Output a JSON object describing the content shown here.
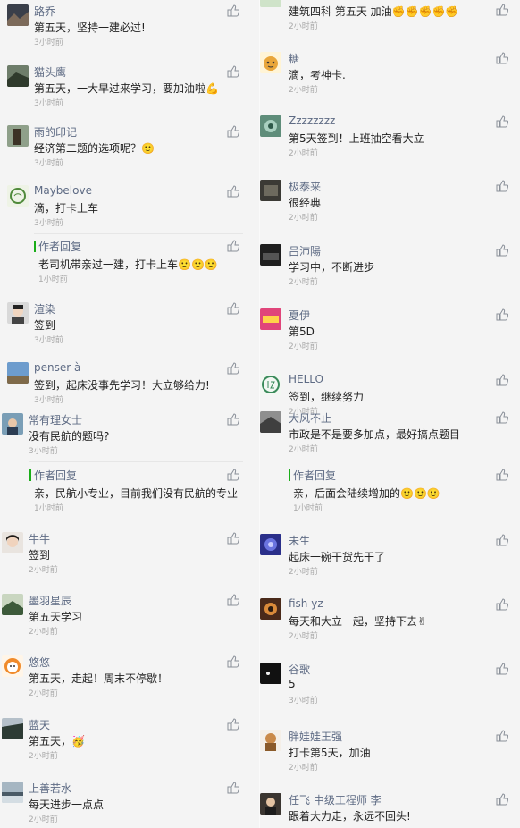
{
  "left": [
    {
      "name": "路乔",
      "text": "第五天，坚持一建必过!",
      "time": "3小时前"
    },
    {
      "name": "猫头鹰",
      "text": "第五天，一大早过来学习，要加油啦💪",
      "time": "3小时前"
    },
    {
      "name": "雨的印记",
      "text": "经济第二题的选项呢？🙂",
      "time": "3小时前"
    },
    {
      "name": "Maybelove",
      "text": "滴，打卡上车",
      "time": "3小时前"
    },
    {
      "reply_label": "作者回复",
      "text": "老司机带亲过一建，打卡上车🙂🙂🙂",
      "time": "1小时前"
    },
    {
      "name": "渲染",
      "text": "签到",
      "time": "3小时前"
    },
    {
      "name": "penser à",
      "text": "签到，起床没事先学习！大立够给力!",
      "time": "3小时前"
    },
    {
      "name": "常有理女士",
      "text": "没有民航的题吗?",
      "time": "3小时前"
    },
    {
      "reply_label": "作者回复",
      "text": "亲，民航小专业，目前我们没有民航的专业",
      "time": "1小时前"
    },
    {
      "name": "牛牛",
      "text": "签到",
      "time": "2小时前"
    },
    {
      "name": "墨羽星辰",
      "text": "第五天学习",
      "time": "2小时前"
    },
    {
      "name": "悠悠",
      "text": "第五天，走起！周末不停歇！",
      "time": "2小时前"
    },
    {
      "name": "蓝天",
      "text": "第五天，🥳",
      "time": "2小时前"
    },
    {
      "name": "上善若水",
      "text": "每天进步一点点",
      "time": "2小时前"
    }
  ],
  "right": [
    {
      "name": "",
      "text": "建筑四科 第五天 加油✊✊✊✊✊",
      "time": "2小时前"
    },
    {
      "name": "糖",
      "text": "滴，考神卡.",
      "time": "2小时前"
    },
    {
      "name": "Zzzzzzzz",
      "text": "第5天签到！上班抽空看大立",
      "time": "2小时前"
    },
    {
      "name": "极泰来",
      "text": "很经典",
      "time": "2小时前"
    },
    {
      "name": "吕沛陽",
      "text": "学习中，不断进步",
      "time": "2小时前"
    },
    {
      "name": "夏伊",
      "text": "第5D",
      "time": "2小时前"
    },
    {
      "name": "HELLO",
      "text": "签到，继续努力",
      "time": "2小时前"
    },
    {
      "name": "大风不止",
      "text": "市政是不是要多加点，最好搞点题目",
      "time": "2小时前"
    },
    {
      "reply_label": "作者回复",
      "text": "亲，后面会陆续增加的🙂🙂🙂",
      "time": "1小时前"
    },
    {
      "name": "未生",
      "text": "起床一碗干货先干了",
      "time": "2小时前"
    },
    {
      "name": "fish yz",
      "text": "每天和大立一起，坚持下去✌",
      "time": "2小时前"
    },
    {
      "name": "谷歌",
      "text": "5",
      "time": "3小时前"
    },
    {
      "name": "胖娃娃王强",
      "text": "打卡第5天，加油",
      "time": "2小时前"
    },
    {
      "name": "任飞 中级工程师 李",
      "text": "跟着大力走，永远不回头!",
      "time": "2小时前"
    }
  ],
  "icons": {
    "like": "thumb-up-icon",
    "avatar": "avatar-image"
  },
  "colors": {
    "name": "#5e6b84",
    "reply_bar": "#1aad19",
    "time": "#a9a9a9",
    "like": "#8a9099"
  }
}
